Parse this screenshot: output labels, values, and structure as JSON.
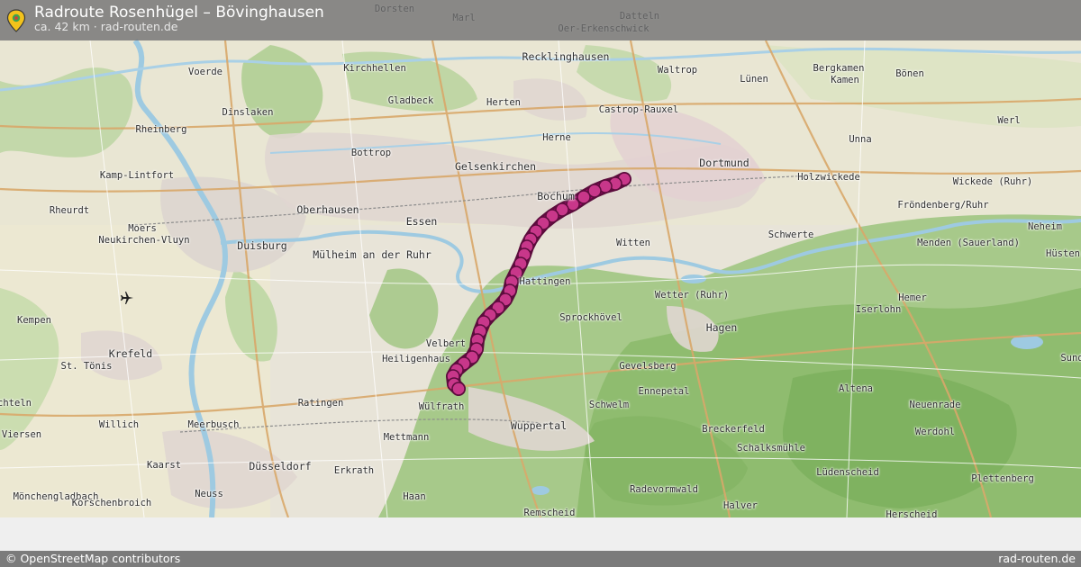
{
  "header": {
    "title": "Radroute Rosenhügel – Bövinghausen",
    "subtitle": "ca. 42 km · rad-routen.de"
  },
  "footer": {
    "attribution": "© OpenStreetMap contributors",
    "site": "rad-routen.de"
  },
  "colors": {
    "route": "#a3006b",
    "route_outline": "#5c0c3d",
    "header_bg": "#6e6e6e",
    "water": "#9ecae1",
    "forest": "#8fbf72"
  },
  "icons": [
    "location-pin-icon",
    "airport-icon"
  ],
  "places": [
    {
      "id": "dorsten",
      "name": "Dorsten"
    },
    {
      "id": "datteln",
      "name": "Datteln"
    },
    {
      "id": "marl",
      "name": "Marl"
    },
    {
      "id": "oer",
      "name": "Oer-Erkenschwick"
    },
    {
      "id": "voerde",
      "name": "Voerde"
    },
    {
      "id": "kirchhellen",
      "name": "Kirchhellen"
    },
    {
      "id": "recklinghausen",
      "name": "Recklinghausen"
    },
    {
      "id": "waltrop",
      "name": "Waltrop"
    },
    {
      "id": "bergkamen",
      "name": "Bergkamen"
    },
    {
      "id": "boenen",
      "name": "Bönen"
    },
    {
      "id": "kamen",
      "name": "Kamen"
    },
    {
      "id": "luenen",
      "name": "Lünen"
    },
    {
      "id": "herten",
      "name": "Herten"
    },
    {
      "id": "gladbeck",
      "name": "Gladbeck"
    },
    {
      "id": "dinslaken",
      "name": "Dinslaken"
    },
    {
      "id": "castrop",
      "name": "Castrop-Rauxel"
    },
    {
      "id": "werl",
      "name": "Werl"
    },
    {
      "id": "rheinberg",
      "name": "Rheinberg"
    },
    {
      "id": "herne",
      "name": "Herne"
    },
    {
      "id": "unna",
      "name": "Unna"
    },
    {
      "id": "bottrop",
      "name": "Bottrop"
    },
    {
      "id": "gelsenkirchen",
      "name": "Gelsenkirchen"
    },
    {
      "id": "dortmund",
      "name": "Dortmund"
    },
    {
      "id": "kamp",
      "name": "Kamp-Lintfort"
    },
    {
      "id": "holzwickede",
      "name": "Holzwickede"
    },
    {
      "id": "bochum",
      "name": "Bochum"
    },
    {
      "id": "wickede",
      "name": "Wickede (Ruhr)"
    },
    {
      "id": "rheurdt",
      "name": "Rheurdt"
    },
    {
      "id": "oberhausen",
      "name": "Oberhausen"
    },
    {
      "id": "froendenberg",
      "name": "Fröndenberg/Ruhr"
    },
    {
      "id": "moers",
      "name": "Moers"
    },
    {
      "id": "essen",
      "name": "Essen"
    },
    {
      "id": "neheim",
      "name": "Neheim"
    },
    {
      "id": "neukirchen",
      "name": "Neukirchen-Vluyn"
    },
    {
      "id": "schwerte",
      "name": "Schwerte"
    },
    {
      "id": "duisburg",
      "name": "Duisburg"
    },
    {
      "id": "witten",
      "name": "Witten"
    },
    {
      "id": "menden",
      "name": "Menden (Sauerland)"
    },
    {
      "id": "muelheim",
      "name": "Mülheim an der Ruhr"
    },
    {
      "id": "huesten",
      "name": "Hüsten"
    },
    {
      "id": "hattingen",
      "name": "Hattingen"
    },
    {
      "id": "wetter",
      "name": "Wetter (Ruhr)"
    },
    {
      "id": "hemer",
      "name": "Hemer"
    },
    {
      "id": "kempen",
      "name": "Kempen"
    },
    {
      "id": "sprockhoevel",
      "name": "Sprockhövel"
    },
    {
      "id": "iserlohn",
      "name": "Iserlohn"
    },
    {
      "id": "hagen",
      "name": "Hagen"
    },
    {
      "id": "velbert",
      "name": "Velbert"
    },
    {
      "id": "krefeld",
      "name": "Krefeld"
    },
    {
      "id": "heiligenhaus",
      "name": "Heiligenhaus"
    },
    {
      "id": "sttoenis",
      "name": "St. Tönis"
    },
    {
      "id": "gevelsberg",
      "name": "Gevelsberg"
    },
    {
      "id": "sund",
      "name": "Sund"
    },
    {
      "id": "altena",
      "name": "Altena"
    },
    {
      "id": "ennepetal",
      "name": "Ennepetal"
    },
    {
      "id": "ratingen",
      "name": "Ratingen"
    },
    {
      "id": "schwelm",
      "name": "Schwelm"
    },
    {
      "id": "neuenrade",
      "name": "Neuenrade"
    },
    {
      "id": "wuelfrath",
      "name": "Wülfrath"
    },
    {
      "id": "schelm",
      "name": "chteln"
    },
    {
      "id": "willich",
      "name": "Willich"
    },
    {
      "id": "meerbusch",
      "name": "Meerbusch"
    },
    {
      "id": "wuppertal",
      "name": "Wuppertal"
    },
    {
      "id": "breckerfeld",
      "name": "Breckerfeld"
    },
    {
      "id": "werdohl",
      "name": "Werdohl"
    },
    {
      "id": "viersen",
      "name": "Viersen"
    },
    {
      "id": "mettmann",
      "name": "Mettmann"
    },
    {
      "id": "schalksmuehle",
      "name": "Schalksmühle"
    },
    {
      "id": "kaarst",
      "name": "Kaarst"
    },
    {
      "id": "duesseldorf",
      "name": "Düsseldorf"
    },
    {
      "id": "erkrath",
      "name": "Erkrath"
    },
    {
      "id": "luedenscheid",
      "name": "Lüdenscheid"
    },
    {
      "id": "plettenberg",
      "name": "Plettenberg"
    },
    {
      "id": "neuss",
      "name": "Neuss"
    },
    {
      "id": "radevormwald",
      "name": "Radevormwald"
    },
    {
      "id": "moenchengladbach",
      "name": "Mönchengladbach"
    },
    {
      "id": "korschenbroich",
      "name": "Korschenbroich"
    },
    {
      "id": "haan",
      "name": "Haan"
    },
    {
      "id": "halver",
      "name": "Halver"
    },
    {
      "id": "remscheid",
      "name": "Remscheid"
    },
    {
      "id": "herscheid",
      "name": "Herscheid"
    }
  ]
}
